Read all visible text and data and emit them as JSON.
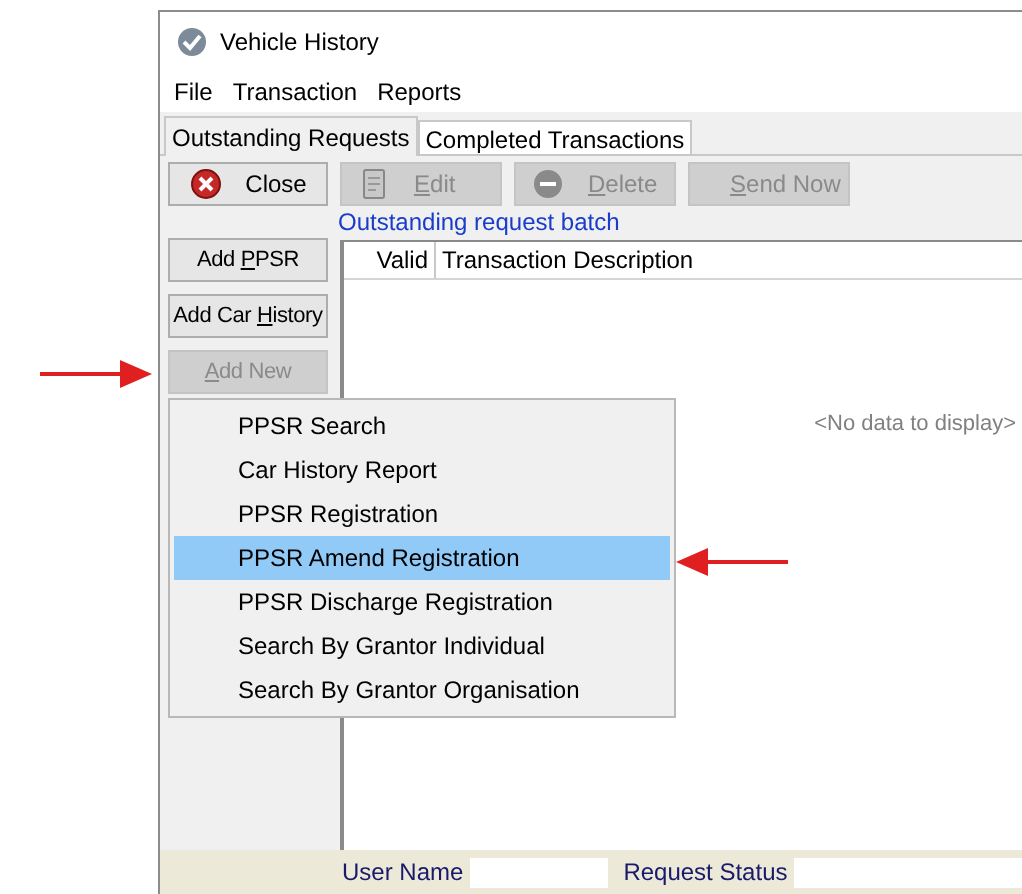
{
  "window": {
    "title": "Vehicle History"
  },
  "menu": [
    "File",
    "Transaction",
    "Reports"
  ],
  "tabs": [
    {
      "label": "Outstanding Requests",
      "selected": true
    },
    {
      "label": "Completed Transactions",
      "selected": false
    }
  ],
  "toolbar": [
    {
      "kind": "close",
      "label": {
        "after": "Close"
      },
      "disabled": false
    },
    {
      "kind": "edit",
      "label": {
        "key": "E",
        "after": "dit"
      },
      "disabled": true
    },
    {
      "kind": "delete",
      "label": {
        "key": "D",
        "after": "elete"
      },
      "disabled": true
    },
    {
      "kind": "send",
      "label": {
        "key": "S",
        "after": "end Now"
      },
      "disabled": true
    }
  ],
  "batch_label": "Outstanding request batch",
  "side_buttons": [
    {
      "label": {
        "before": "Add ",
        "key": "P",
        "after": "PSR"
      },
      "disabled": false
    },
    {
      "label": {
        "before": "Add Car ",
        "key": "H",
        "after": "istory"
      },
      "disabled": false
    },
    {
      "label": {
        "key": "A",
        "after": "dd New"
      },
      "disabled": true
    }
  ],
  "table": {
    "columns": [
      "Valid",
      "Transaction Description"
    ],
    "empty_text": "<No data to display>"
  },
  "popup_menu": [
    {
      "label": "PPSR Search",
      "selected": false
    },
    {
      "label": "Car History Report",
      "selected": false
    },
    {
      "label": "PPSR Registration",
      "selected": false
    },
    {
      "label": "PPSR Amend Registration",
      "selected": true
    },
    {
      "label": "PPSR Discharge Registration",
      "selected": false
    },
    {
      "label": "Search By Grantor Individual",
      "selected": false
    },
    {
      "label": "Search By Grantor Organisation",
      "selected": false
    }
  ],
  "status_bar": {
    "fields": [
      {
        "label": "User Name"
      },
      {
        "label": "Request Status"
      }
    ]
  }
}
